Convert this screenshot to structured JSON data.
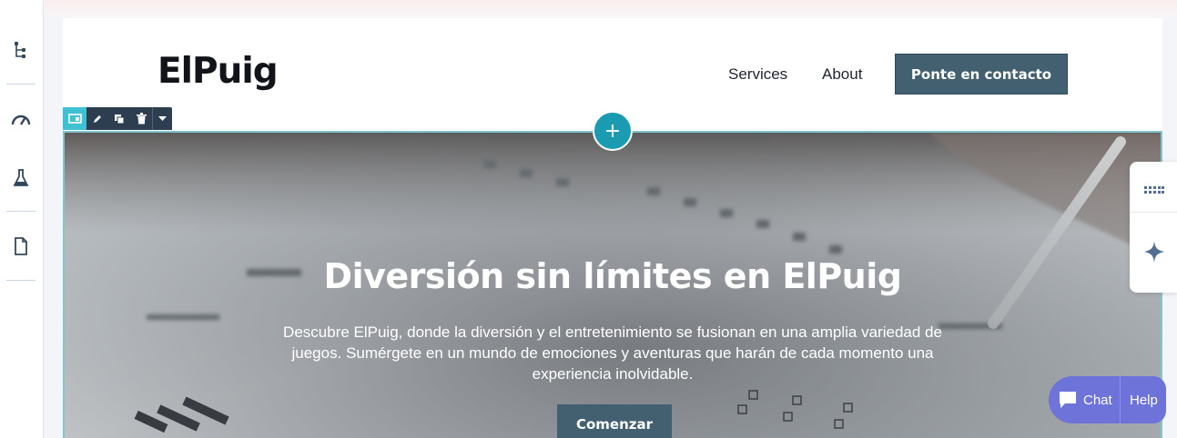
{
  "site": {
    "logo": "ElPuig",
    "nav": [
      {
        "label": "Services"
      },
      {
        "label": "About"
      }
    ],
    "cta_label": "Ponte en contacto"
  },
  "hero": {
    "title": "Diversión sin límites en ElPuig",
    "text": "Descubre ElPuig, donde la diversión y el entretenimiento se fusionan en una amplia variedad de juegos. Sumérgete en un mundo de emociones y aventuras que harán de cada momento una experiencia inolvidable.",
    "button_label": "Comenzar"
  },
  "editor": {
    "add_section_symbol": "+",
    "left_rail_icons": [
      "tree-structure-icon",
      "speedometer-icon",
      "flask-icon",
      "document-icon"
    ],
    "module_toolbar_icons": [
      "layout-icon",
      "pencil-icon",
      "duplicate-icon",
      "trash-icon",
      "caret-down-icon"
    ],
    "right_panel_icons": [
      "grid-dots-icon",
      "sparkle-icon"
    ]
  },
  "chat_widget": {
    "chat_label": "Chat",
    "help_label": "Help"
  },
  "colors": {
    "brand_button": "#42606f",
    "accent_teal": "#1a9bb1",
    "chat_purple": "#6d73d9",
    "toolbar_dark": "#2d3e50"
  }
}
